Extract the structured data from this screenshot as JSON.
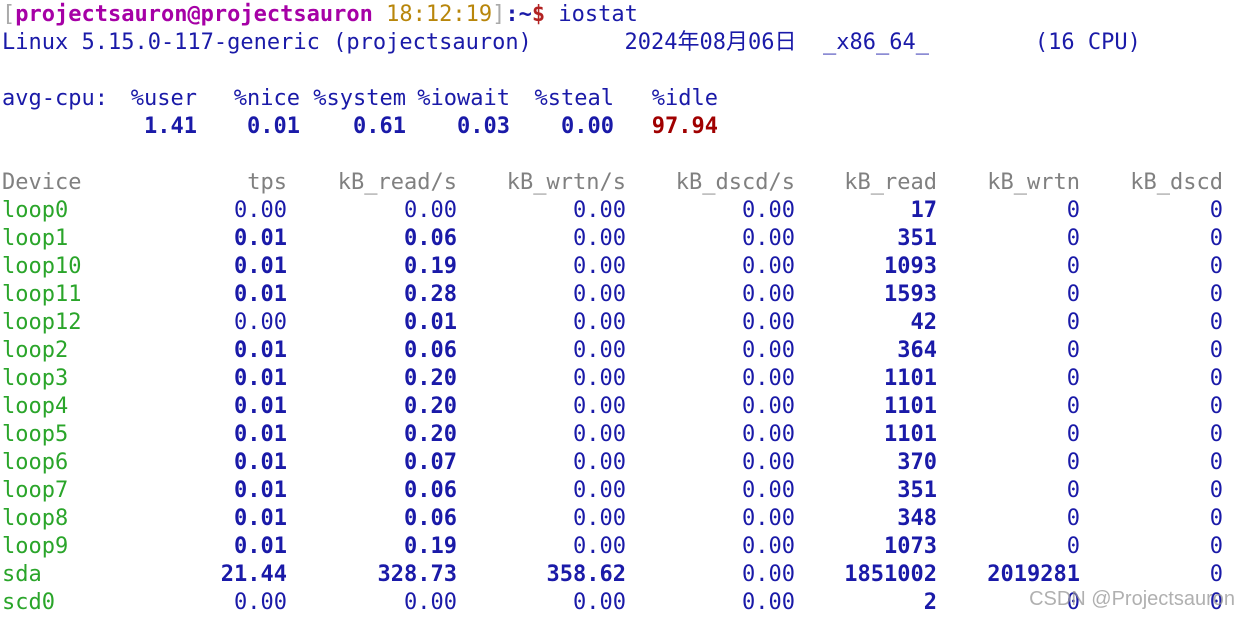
{
  "prompt": {
    "bracket_open": "[",
    "user_host": "projectsauron@projectsauron",
    "time": "18:12:19",
    "bracket_close": "]",
    "path": ":~",
    "dollar": "$",
    "command": " iostat"
  },
  "sysinfo": "Linux 5.15.0-117-generic (projectsauron)       2024年08月06日  _x86_64_        (16 CPU)",
  "cpu": {
    "label": "avg-cpu:",
    "headers": [
      "%user",
      "%nice",
      "%system",
      "%iowait",
      "%steal",
      "%idle"
    ],
    "values": [
      "1.41",
      "0.01",
      "0.61",
      "0.03",
      "0.00",
      "97.94"
    ]
  },
  "devices": {
    "headers": [
      "Device",
      "tps",
      "kB_read/s",
      "kB_wrtn/s",
      "kB_dscd/s",
      "kB_read",
      "kB_wrtn",
      "kB_dscd"
    ],
    "rows": [
      [
        "loop0",
        "0.00",
        "0.00",
        "0.00",
        "0.00",
        "17",
        "0",
        "0"
      ],
      [
        "loop1",
        "0.01",
        "0.06",
        "0.00",
        "0.00",
        "351",
        "0",
        "0"
      ],
      [
        "loop10",
        "0.01",
        "0.19",
        "0.00",
        "0.00",
        "1093",
        "0",
        "0"
      ],
      [
        "loop11",
        "0.01",
        "0.28",
        "0.00",
        "0.00",
        "1593",
        "0",
        "0"
      ],
      [
        "loop12",
        "0.00",
        "0.01",
        "0.00",
        "0.00",
        "42",
        "0",
        "0"
      ],
      [
        "loop2",
        "0.01",
        "0.06",
        "0.00",
        "0.00",
        "364",
        "0",
        "0"
      ],
      [
        "loop3",
        "0.01",
        "0.20",
        "0.00",
        "0.00",
        "1101",
        "0",
        "0"
      ],
      [
        "loop4",
        "0.01",
        "0.20",
        "0.00",
        "0.00",
        "1101",
        "0",
        "0"
      ],
      [
        "loop5",
        "0.01",
        "0.20",
        "0.00",
        "0.00",
        "1101",
        "0",
        "0"
      ],
      [
        "loop6",
        "0.01",
        "0.07",
        "0.00",
        "0.00",
        "370",
        "0",
        "0"
      ],
      [
        "loop7",
        "0.01",
        "0.06",
        "0.00",
        "0.00",
        "351",
        "0",
        "0"
      ],
      [
        "loop8",
        "0.01",
        "0.06",
        "0.00",
        "0.00",
        "348",
        "0",
        "0"
      ],
      [
        "loop9",
        "0.01",
        "0.19",
        "0.00",
        "0.00",
        "1073",
        "0",
        "0"
      ],
      [
        "sda",
        "21.44",
        "328.73",
        "358.62",
        "0.00",
        "1851002",
        "2019281",
        "0"
      ],
      [
        "scd0",
        "0.00",
        "0.00",
        "0.00",
        "0.00",
        "2",
        "0",
        "0"
      ]
    ]
  },
  "watermark": "CSDN @Projectsauron",
  "colors": {
    "user_host": "#a600a6",
    "time": "#b8860b",
    "value_blue": "#1a1aa8",
    "device_green": "#2aa52a",
    "header_gray": "#808080",
    "idle_red": "#a00000"
  }
}
